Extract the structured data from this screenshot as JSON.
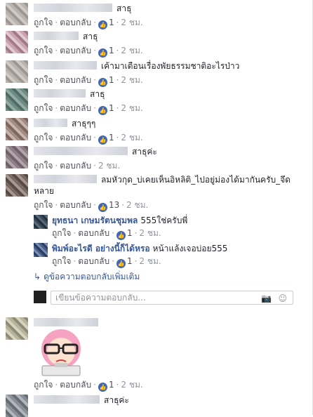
{
  "actions": {
    "like": "ถูกใจ",
    "reply": "ตอบกลับ"
  },
  "comments": [
    {
      "text": "สาธุ",
      "likes": "1",
      "time": "2 ชม."
    },
    {
      "text": "สาธุ",
      "likes": "1",
      "time": "2 ชม."
    },
    {
      "text": "เค้ามาเตือนเรื่องพัยธรรมชาติอะไรป่าว",
      "likes": "1",
      "time": "2 ชม."
    },
    {
      "text": "สาธุ",
      "likes": "1",
      "time": "2 ชม."
    },
    {
      "text": "สาธุๆๆ",
      "likes": "1",
      "time": "2 ชม."
    },
    {
      "text": "สาธุค่ะ",
      "time": "2 ชม."
    },
    {
      "text_line1": "ลมหัวกุด_บ่เคยเห็นอิหลิติ_ไปอยู่ม่องได้มากันครับ_จึด",
      "text_line2": "หลาย",
      "likes": "13",
      "time": "2 ชม."
    },
    {
      "sticker": true,
      "likes": "1",
      "time": "2 ชม."
    },
    {
      "text": "สาธุค่ะ"
    }
  ],
  "replies": [
    {
      "name": "ยุทธนา เกษมรัตนชุมพล",
      "text": "555ใช่ครับพี่",
      "likes": "1",
      "time": "2 ชม."
    },
    {
      "name": "พิมพ์อะไรดี อย่างนี้ก็ได้หรอ",
      "text": "หน้าแล้งเจอบ่อย555",
      "likes": "1",
      "time": "2 ชม."
    }
  ],
  "more_replies": "ดูข้อความตอบกลับเพิ่มเติม",
  "reply_placeholder": "เขียนข้อความตอบกลับ...",
  "icons": {
    "like": "thumbs-up-icon",
    "camera": "camera-icon",
    "emoji": "emoji-icon",
    "reply_arrow": "reply-arrow-icon"
  },
  "colors": {
    "link": "#365899",
    "like_badge": "#4267b2",
    "meta": "#90949c"
  }
}
